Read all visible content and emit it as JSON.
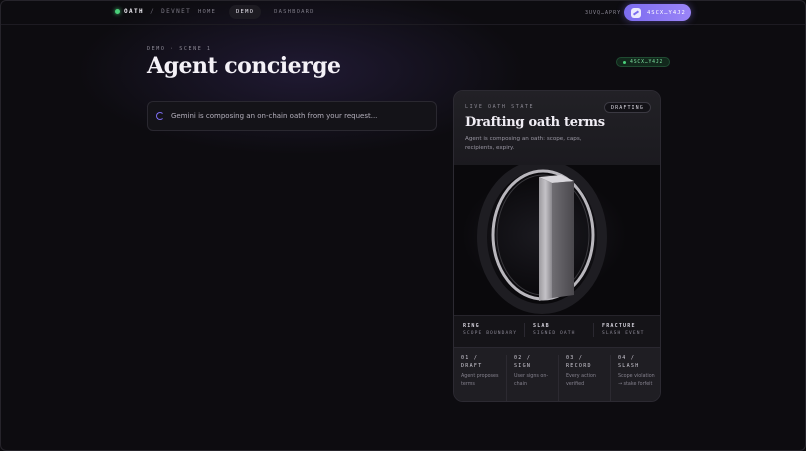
{
  "nav": {
    "brand": "OATH",
    "separator": "/",
    "network": "DEVNET",
    "links": [
      {
        "label": "HOME",
        "active": false
      },
      {
        "label": "DEMO",
        "active": true
      },
      {
        "label": "DASHBOARD",
        "active": false
      }
    ],
    "wallet_balance": "3UVQ…APRY",
    "wallet_button": "4SCX…Y4J2"
  },
  "header": {
    "eyebrow": "DEMO · SCENE 1",
    "title": "Agent concierge",
    "badge": "4SCX…Y4J2"
  },
  "status": {
    "text": "Gemini is composing an on-chain oath from your request..."
  },
  "card": {
    "eyebrow": "LIVE OATH STATE",
    "state": "DRAFTING",
    "title": "Drafting oath terms",
    "description": "Agent is composing an oath: scope, caps, recipients, expiry.",
    "legend": [
      {
        "title": "RING",
        "sub": "SCOPE BOUNDARY"
      },
      {
        "title": "SLAB",
        "sub": "SIGNED OATH"
      },
      {
        "title": "FRACTURE",
        "sub": "SLASH EVENT"
      }
    ],
    "steps": [
      {
        "title": "01 / DRAFT",
        "desc": "Agent proposes terms"
      },
      {
        "title": "02 / SIGN",
        "desc": "User signs on-chain"
      },
      {
        "title": "03 / RECORD",
        "desc": "Every action verified"
      },
      {
        "title": "04 / SLASH",
        "desc": "Scope violation → stake forfeit"
      }
    ]
  },
  "colors": {
    "accent": "#7c6cf0",
    "success": "#4ad07a",
    "background": "#0d0c10"
  }
}
